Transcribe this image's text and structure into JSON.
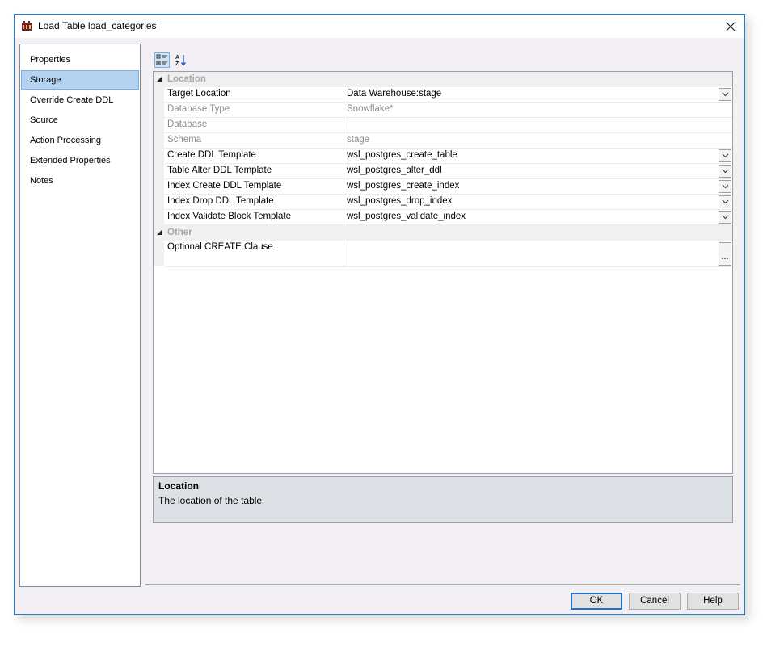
{
  "window": {
    "title": "Load Table load_categories"
  },
  "nav": {
    "items": [
      {
        "label": "Properties",
        "selected": false
      },
      {
        "label": "Storage",
        "selected": true
      },
      {
        "label": "Override Create DDL",
        "selected": false
      },
      {
        "label": "Source",
        "selected": false
      },
      {
        "label": "Action Processing",
        "selected": false
      },
      {
        "label": "Extended Properties",
        "selected": false
      },
      {
        "label": "Notes",
        "selected": false
      }
    ]
  },
  "toolbar": {
    "categorized_icon": "categorized-icon",
    "alphabetical_icon": "sort-alphabetical-icon"
  },
  "grid": {
    "location": {
      "label": "Location",
      "rows": [
        {
          "name": "Target Location",
          "value": "Data Warehouse:stage",
          "dropdown": true,
          "disabled": false
        },
        {
          "name": "Database Type",
          "value": "Snowflake*",
          "dropdown": false,
          "disabled": true
        },
        {
          "name": "Database",
          "value": "",
          "dropdown": false,
          "disabled": true
        },
        {
          "name": "Schema",
          "value": "stage",
          "dropdown": false,
          "disabled": true
        },
        {
          "name": "Create DDL Template",
          "value": "wsl_postgres_create_table",
          "dropdown": true,
          "disabled": false
        },
        {
          "name": "Table Alter DDL Template",
          "value": "wsl_postgres_alter_ddl",
          "dropdown": true,
          "disabled": false
        },
        {
          "name": "Index Create DDL Template",
          "value": "wsl_postgres_create_index",
          "dropdown": true,
          "disabled": false
        },
        {
          "name": "Index Drop DDL Template",
          "value": "wsl_postgres_drop_index",
          "dropdown": true,
          "disabled": false
        },
        {
          "name": "Index Validate Block Template",
          "value": "wsl_postgres_validate_index",
          "dropdown": true,
          "disabled": false
        }
      ]
    },
    "other": {
      "label": "Other",
      "rows": [
        {
          "name": "Optional CREATE Clause",
          "value": "",
          "ellipsis": "..."
        }
      ]
    }
  },
  "description": {
    "title": "Location",
    "text": "The location of the table"
  },
  "buttons": {
    "ok": "OK",
    "cancel": "Cancel",
    "help": "Help"
  },
  "colors": {
    "accent": "#1e7fd6",
    "selection": "#b4d3f3",
    "disabled_text": "#8c8c8c",
    "category_text": "#a7a9ad"
  }
}
